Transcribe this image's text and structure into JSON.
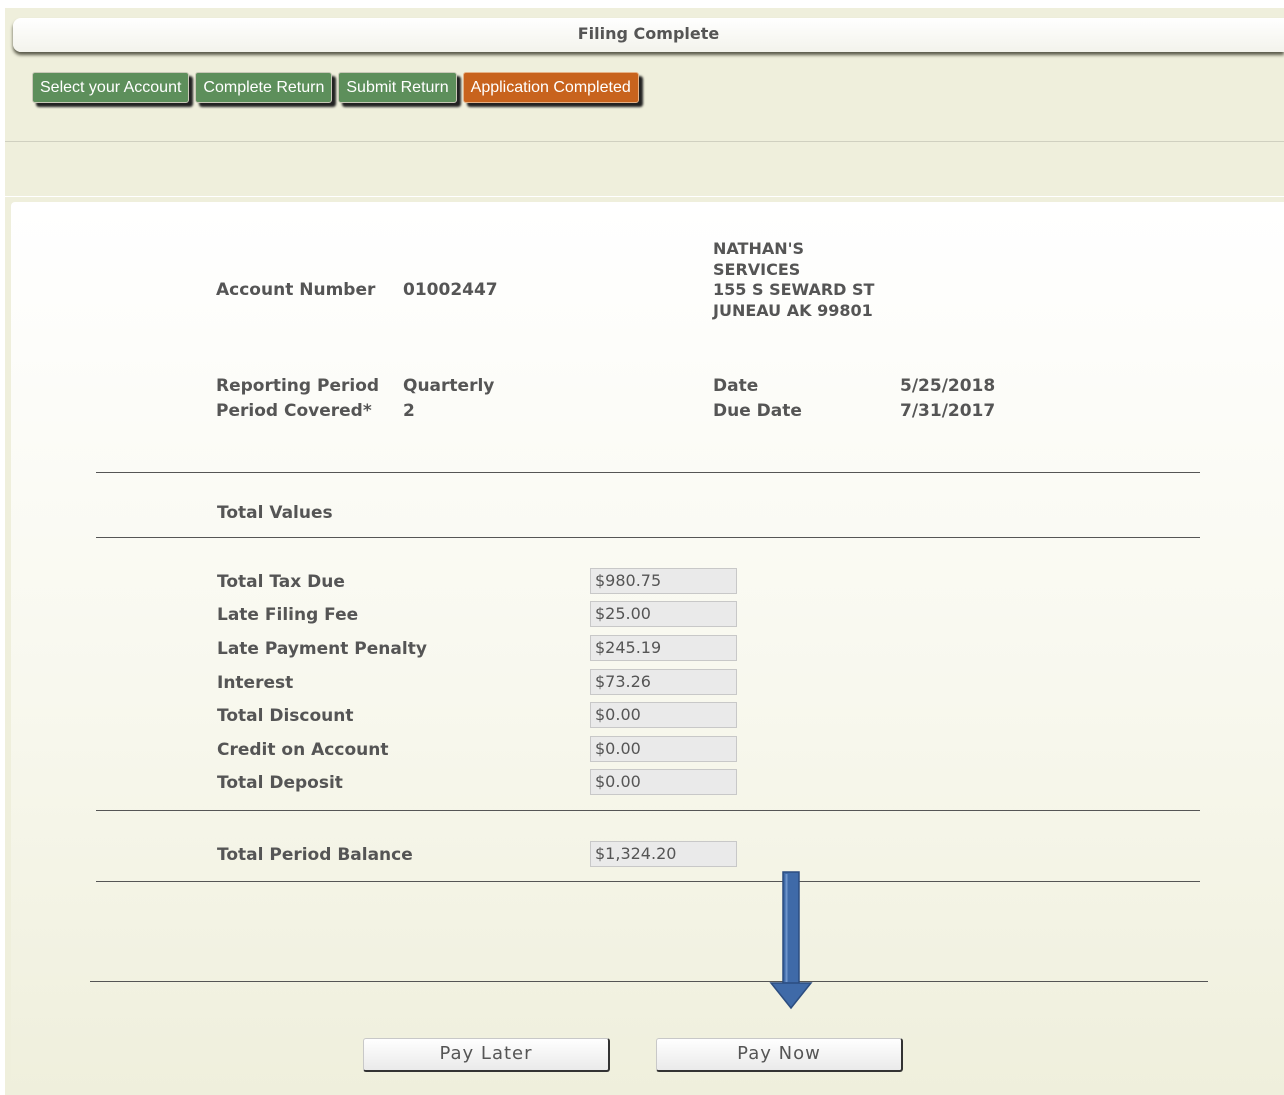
{
  "header": {
    "title": "Filing Complete"
  },
  "steps": [
    {
      "label": "Select your Account",
      "state": "done"
    },
    {
      "label": "Complete Return",
      "state": "done"
    },
    {
      "label": "Submit Return",
      "state": "done"
    },
    {
      "label": "Application Completed",
      "state": "active"
    }
  ],
  "account": {
    "number_label": "Account Number",
    "number": "01002447",
    "address_lines": [
      "NATHAN'S",
      "SERVICES",
      "155 S SEWARD ST",
      "JUNEAU AK 99801"
    ]
  },
  "period": {
    "reporting_period_label": "Reporting Period",
    "reporting_period": "Quarterly",
    "period_covered_label": "Period Covered*",
    "period_covered": "2",
    "date_label": "Date",
    "date": "5/25/2018",
    "due_date_label": "Due Date",
    "due_date": "7/31/2017"
  },
  "totals": {
    "section_title": "Total Values",
    "rows": [
      {
        "label": "Total Tax Due",
        "value": "$980.75"
      },
      {
        "label": "Late Filing Fee",
        "value": "$25.00"
      },
      {
        "label": "Late Payment Penalty",
        "value": "$245.19"
      },
      {
        "label": "Interest",
        "value": "$73.26"
      },
      {
        "label": "Total Discount",
        "value": "$0.00"
      },
      {
        "label": "Credit on Account",
        "value": "$0.00"
      },
      {
        "label": "Total Deposit",
        "value": "$0.00"
      }
    ],
    "balance_label": "Total Period Balance",
    "balance_value": "$1,324.20"
  },
  "actions": {
    "pay_later": "Pay Later",
    "pay_now": "Pay Now"
  },
  "colors": {
    "step_done": "#5d8f5b",
    "step_active": "#c8631d",
    "arrow": "#3f6aa8"
  },
  "annotation": {
    "icon": "down-arrow-icon"
  }
}
